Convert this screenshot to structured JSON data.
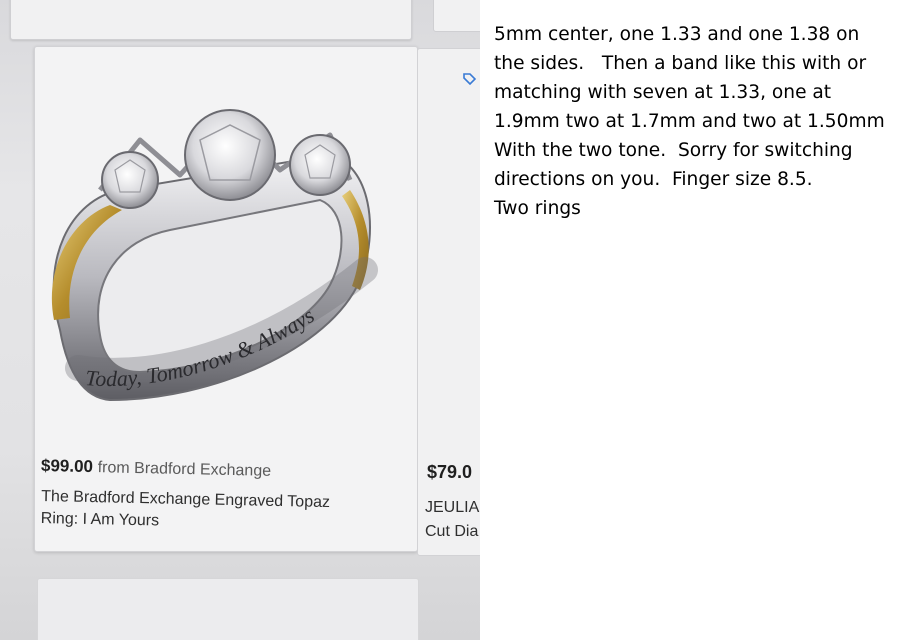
{
  "product": {
    "price": "$99.00",
    "seller": "from Bradford Exchange",
    "title_line1": "The Bradford Exchange Engraved Topaz",
    "title_line2": "Ring: I Am Yours",
    "engraving": "Today, Tomorrow & Always",
    "image_icon": "ring-photo"
  },
  "product_2": {
    "price_partial": "$79.0",
    "title_line1_partial": "JEULIA",
    "title_line2_partial": "Cut Dia"
  },
  "notes": {
    "lines": [
      "5mm center, one 1.33 and one 1.38 on",
      "the sides.   Then a band like this with or",
      "matching with seven at 1.33, one at",
      "1.9mm two at 1.7mm and two at 1.50mm",
      "With the two tone.  Sorry for switching",
      "directions on you.  Finger size 8.5.",
      "Two rings"
    ]
  },
  "colors": {
    "gold": "#c9a24a",
    "silver": "#c8c8cc",
    "screen_bg": "#e2e2e4"
  }
}
